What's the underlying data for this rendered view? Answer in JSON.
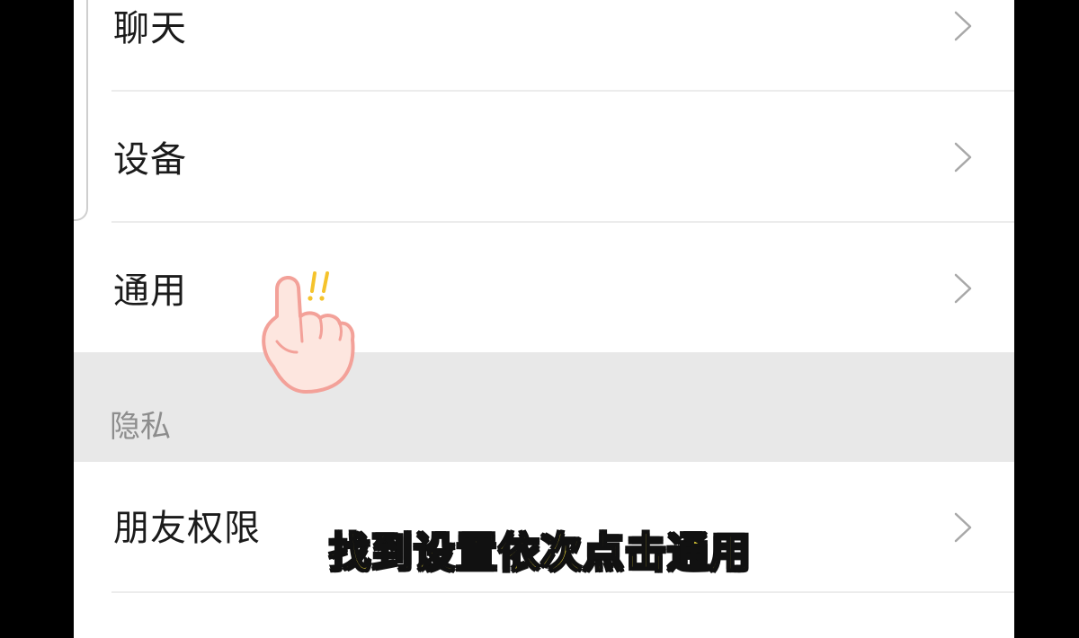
{
  "settings": {
    "items": [
      {
        "label": "聊天"
      },
      {
        "label": "设备"
      },
      {
        "label": "通用"
      }
    ],
    "section_privacy": {
      "title": "隐私",
      "items": [
        {
          "label": "朋友权限"
        }
      ]
    }
  },
  "overlay": {
    "caption": "找到设置依次点击通用",
    "pointer_icon": "pointing-hand-icon",
    "exclaim_icon": "double-exclamation-icon"
  },
  "colors": {
    "background": "#ffffff",
    "section_background": "#e8e8e8",
    "caption_fill": "#f7e33a",
    "caption_outline": "#111111",
    "finger_fill": "#fde6df",
    "finger_outline": "#f3a199",
    "exclaim": "#f5c32c"
  }
}
